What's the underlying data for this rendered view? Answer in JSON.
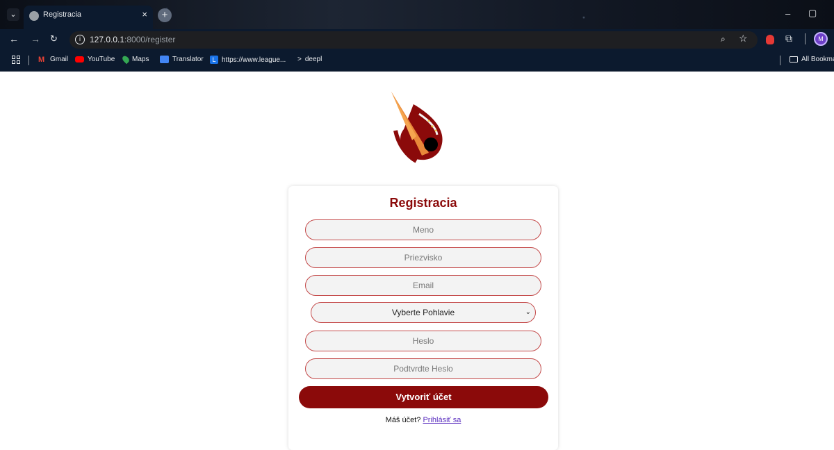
{
  "browser": {
    "tab_title": "Registracia",
    "tab_close": "×",
    "new_tab": "+",
    "url_host": "127.0.0.1",
    "url_path": ":8000/register",
    "avatar_letter": "M",
    "window_min": "–",
    "window_max": "▢",
    "icons": {
      "tab_menu": "chevron-down-icon",
      "back": "back-arrow-icon",
      "forward": "forward-arrow-icon",
      "reload": "reload-icon",
      "site_info": "info-icon",
      "zoom": "zoom-icon",
      "bookmark": "star-icon",
      "extension": "extension-icon",
      "puzzle": "puzzle-icon"
    },
    "bookmarks": [
      {
        "label": "Gmail",
        "color": "#ea4335"
      },
      {
        "label": "YouTube",
        "color": "#ff0000"
      },
      {
        "label": "Maps",
        "color": "#34a853"
      },
      {
        "label": "Translator",
        "color": "#4285f4"
      },
      {
        "label": "https://www.league...",
        "color": "#1a73e8",
        "letter": "L"
      },
      {
        "label": "deepl",
        "prefix": ">"
      }
    ],
    "all_bookmarks": "All Bookma"
  },
  "page": {
    "title": "Registracia",
    "fields": {
      "first_name": "Meno",
      "last_name": "Priezvisko",
      "email": "Email",
      "gender_select": "Vyberte Pohlavie",
      "password": "Heslo",
      "confirm_password": "Podtvrdte Heslo"
    },
    "submit_label": "Vytvoriť účet",
    "login_prompt": "Máš účet?",
    "login_link": "Prihlásiť sa"
  },
  "colors": {
    "accent": "#8b0a0a",
    "field_border": "#c44a4a",
    "link": "#5b2fc0"
  }
}
